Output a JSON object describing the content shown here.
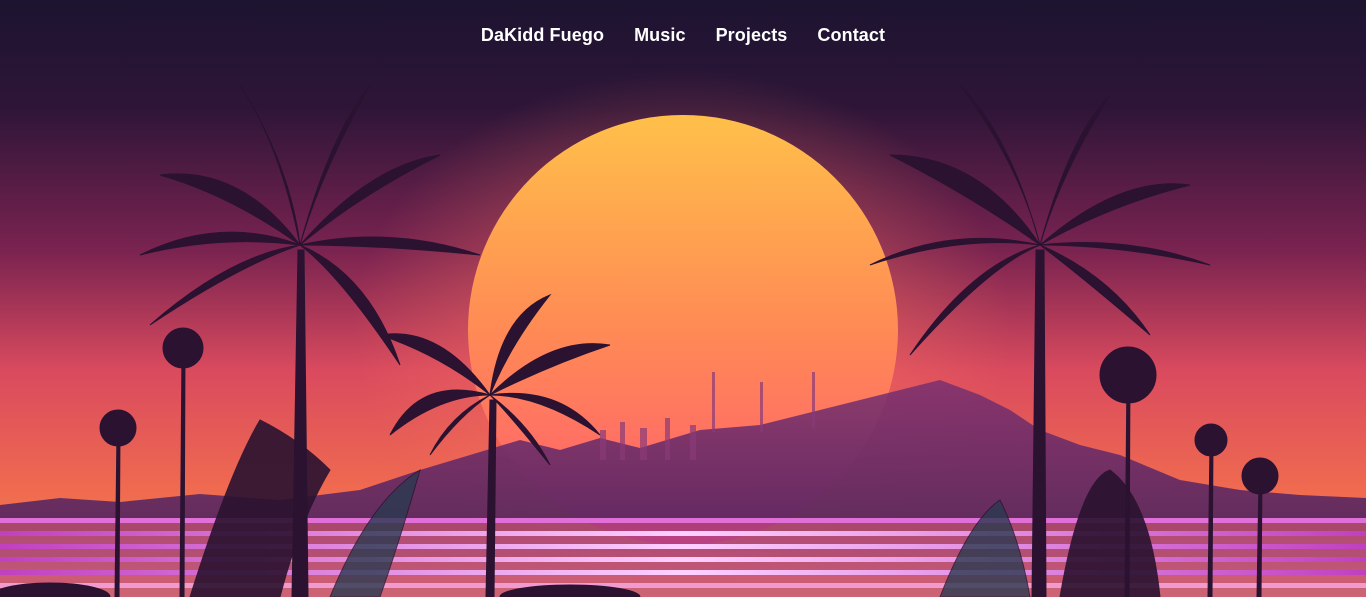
{
  "nav": {
    "items": [
      {
        "label": "DaKidd Fuego"
      },
      {
        "label": "Music"
      },
      {
        "label": "Projects"
      },
      {
        "label": "Contact"
      }
    ]
  },
  "hero": {
    "image": "synthwave-sunset-palm-trees",
    "colors": {
      "sky_top": "#1c1430",
      "sky_mid": "#8a2a5a",
      "sky_low": "#f0644c",
      "sun_top": "#ffb347",
      "sun_bottom": "#ff5a6a",
      "palm": "#2a1230",
      "neon_lines": "#ff8adf"
    }
  }
}
